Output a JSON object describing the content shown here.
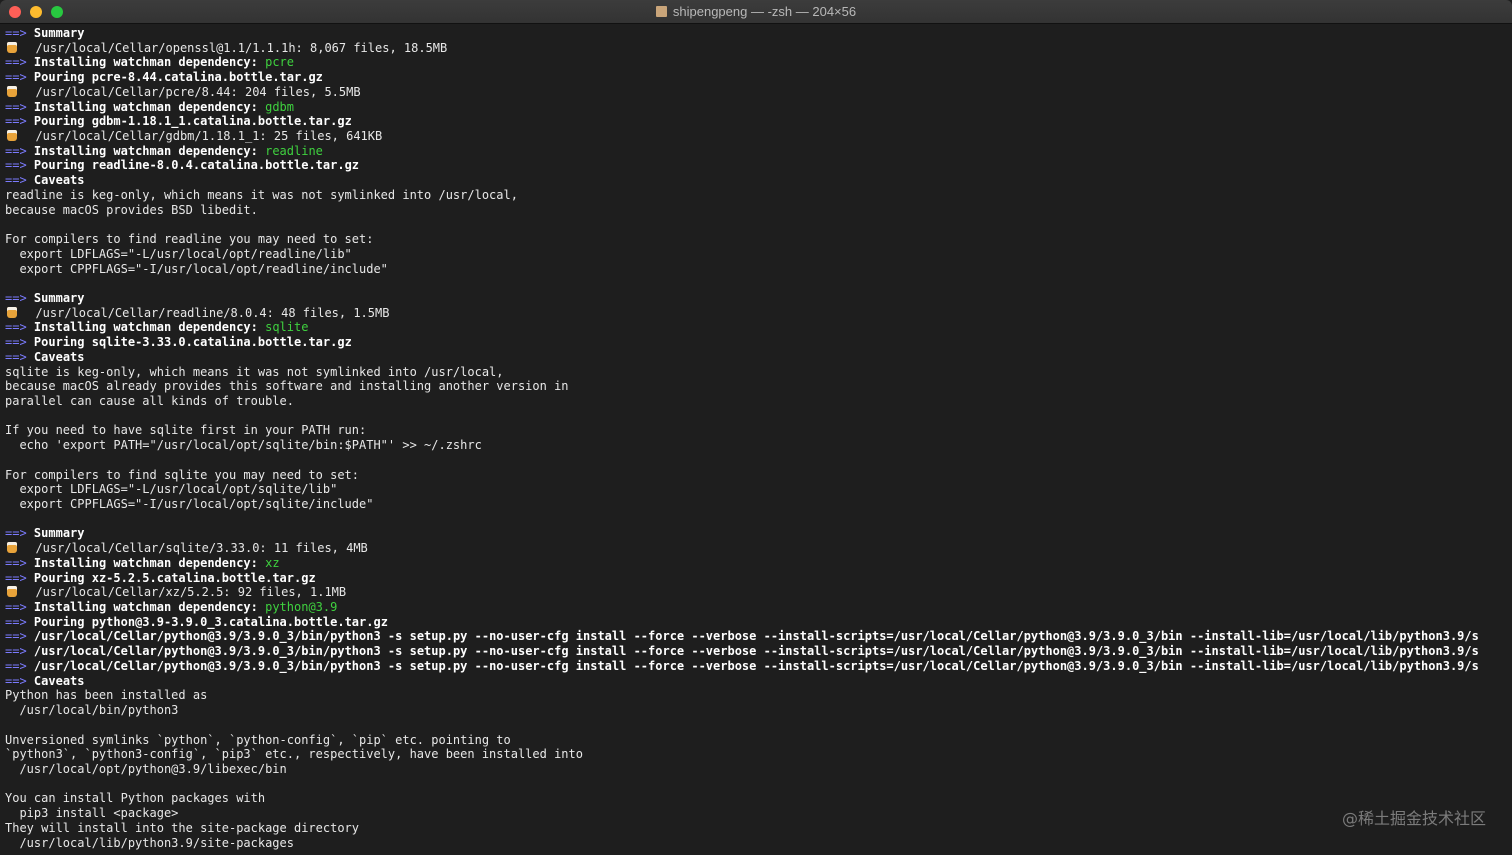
{
  "window": {
    "title": "shipengpeng — -zsh — 204×56"
  },
  "watermark": "@稀土掘金技术社区",
  "lines": [
    {
      "t": "h",
      "text": "Summary"
    },
    {
      "t": "b",
      "text": "/usr/local/Cellar/openssl@1.1/1.1.1h: 8,067 files, 18.5MB"
    },
    {
      "t": "h",
      "text": "Installing watchman dependency: ",
      "green": "pcre"
    },
    {
      "t": "h",
      "text": "Pouring pcre-8.44.catalina.bottle.tar.gz"
    },
    {
      "t": "b",
      "text": "/usr/local/Cellar/pcre/8.44: 204 files, 5.5MB"
    },
    {
      "t": "h",
      "text": "Installing watchman dependency: ",
      "green": "gdbm"
    },
    {
      "t": "h",
      "text": "Pouring gdbm-1.18.1_1.catalina.bottle.tar.gz"
    },
    {
      "t": "b",
      "text": "/usr/local/Cellar/gdbm/1.18.1_1: 25 files, 641KB"
    },
    {
      "t": "h",
      "text": "Installing watchman dependency: ",
      "green": "readline"
    },
    {
      "t": "h",
      "text": "Pouring readline-8.0.4.catalina.bottle.tar.gz"
    },
    {
      "t": "h",
      "text": "Caveats"
    },
    {
      "t": "p",
      "text": "readline is keg-only, which means it was not symlinked into /usr/local,"
    },
    {
      "t": "p",
      "text": "because macOS provides BSD libedit."
    },
    {
      "t": "p",
      "text": ""
    },
    {
      "t": "p",
      "text": "For compilers to find readline you may need to set:"
    },
    {
      "t": "p",
      "text": "  export LDFLAGS=\"-L/usr/local/opt/readline/lib\""
    },
    {
      "t": "p",
      "text": "  export CPPFLAGS=\"-I/usr/local/opt/readline/include\""
    },
    {
      "t": "p",
      "text": ""
    },
    {
      "t": "h",
      "text": "Summary"
    },
    {
      "t": "b",
      "text": "/usr/local/Cellar/readline/8.0.4: 48 files, 1.5MB"
    },
    {
      "t": "h",
      "text": "Installing watchman dependency: ",
      "green": "sqlite"
    },
    {
      "t": "h",
      "text": "Pouring sqlite-3.33.0.catalina.bottle.tar.gz"
    },
    {
      "t": "h",
      "text": "Caveats"
    },
    {
      "t": "p",
      "text": "sqlite is keg-only, which means it was not symlinked into /usr/local,"
    },
    {
      "t": "p",
      "text": "because macOS already provides this software and installing another version in"
    },
    {
      "t": "p",
      "text": "parallel can cause all kinds of trouble."
    },
    {
      "t": "p",
      "text": ""
    },
    {
      "t": "p",
      "text": "If you need to have sqlite first in your PATH run:"
    },
    {
      "t": "p",
      "text": "  echo 'export PATH=\"/usr/local/opt/sqlite/bin:$PATH\"' >> ~/.zshrc"
    },
    {
      "t": "p",
      "text": ""
    },
    {
      "t": "p",
      "text": "For compilers to find sqlite you may need to set:"
    },
    {
      "t": "p",
      "text": "  export LDFLAGS=\"-L/usr/local/opt/sqlite/lib\""
    },
    {
      "t": "p",
      "text": "  export CPPFLAGS=\"-I/usr/local/opt/sqlite/include\""
    },
    {
      "t": "p",
      "text": ""
    },
    {
      "t": "h",
      "text": "Summary"
    },
    {
      "t": "b",
      "text": "/usr/local/Cellar/sqlite/3.33.0: 11 files, 4MB"
    },
    {
      "t": "h",
      "text": "Installing watchman dependency: ",
      "green": "xz"
    },
    {
      "t": "h",
      "text": "Pouring xz-5.2.5.catalina.bottle.tar.gz"
    },
    {
      "t": "b",
      "text": "/usr/local/Cellar/xz/5.2.5: 92 files, 1.1MB"
    },
    {
      "t": "h",
      "text": "Installing watchman dependency: ",
      "green": "python@3.9"
    },
    {
      "t": "h",
      "text": "Pouring python@3.9-3.9.0_3.catalina.bottle.tar.gz"
    },
    {
      "t": "h",
      "text": "/usr/local/Cellar/python@3.9/3.9.0_3/bin/python3 -s setup.py --no-user-cfg install --force --verbose --install-scripts=/usr/local/Cellar/python@3.9/3.9.0_3/bin --install-lib=/usr/local/lib/python3.9/s"
    },
    {
      "t": "h",
      "text": "/usr/local/Cellar/python@3.9/3.9.0_3/bin/python3 -s setup.py --no-user-cfg install --force --verbose --install-scripts=/usr/local/Cellar/python@3.9/3.9.0_3/bin --install-lib=/usr/local/lib/python3.9/s"
    },
    {
      "t": "h",
      "text": "/usr/local/Cellar/python@3.9/3.9.0_3/bin/python3 -s setup.py --no-user-cfg install --force --verbose --install-scripts=/usr/local/Cellar/python@3.9/3.9.0_3/bin --install-lib=/usr/local/lib/python3.9/s"
    },
    {
      "t": "h",
      "text": "Caveats"
    },
    {
      "t": "p",
      "text": "Python has been installed as"
    },
    {
      "t": "p",
      "text": "  /usr/local/bin/python3"
    },
    {
      "t": "p",
      "text": ""
    },
    {
      "t": "p",
      "text": "Unversioned symlinks `python`, `python-config`, `pip` etc. pointing to"
    },
    {
      "t": "p",
      "text": "`python3`, `python3-config`, `pip3` etc., respectively, have been installed into"
    },
    {
      "t": "p",
      "text": "  /usr/local/opt/python@3.9/libexec/bin"
    },
    {
      "t": "p",
      "text": ""
    },
    {
      "t": "p",
      "text": "You can install Python packages with"
    },
    {
      "t": "p",
      "text": "  pip3 install <package>"
    },
    {
      "t": "p",
      "text": "They will install into the site-package directory"
    },
    {
      "t": "p",
      "text": "  /usr/local/lib/python3.9/site-packages"
    }
  ],
  "arrow": "==>",
  "icons": {
    "beer": "beer-mug-icon",
    "home": "house-icon"
  }
}
